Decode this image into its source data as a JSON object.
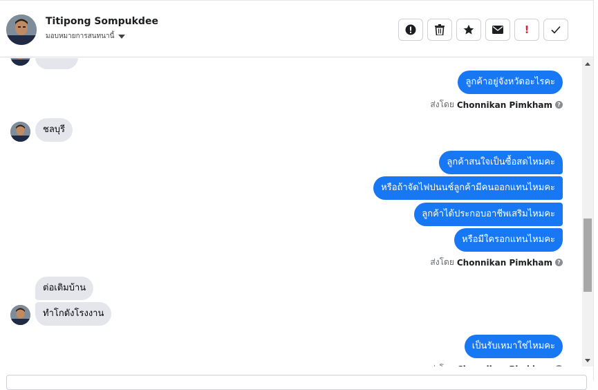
{
  "header": {
    "contact_name": "Titipong Sompukdee",
    "assign_label": "มอบหมายการสนทนานี้",
    "actions": [
      {
        "name": "report-spam-button",
        "icon": "alert-circle-icon"
      },
      {
        "name": "delete-button",
        "icon": "trash-icon"
      },
      {
        "name": "star-button",
        "icon": "star-icon"
      },
      {
        "name": "mark-unread-button",
        "icon": "envelope-icon"
      },
      {
        "name": "follow-up-button",
        "icon": "exclamation-icon",
        "label": "!"
      },
      {
        "name": "mark-done-button",
        "icon": "checkmark-icon"
      }
    ]
  },
  "messages": {
    "out1": "ลูกค้าอยู่จังหวัดอะไรคะ",
    "in1": "ชลบุรี",
    "out2": "ลูกค้าสนใจเป็นซื้อสดไหมคะ",
    "out3": "หรือถ้าจัดไฟปนนช์ลูกค้ามีคนออกแทนไหมคะ",
    "out4": "ลูกค้าได้ประกอบอาชีพเสริมไหมคะ",
    "out5": "หรือมีใครอกแทนไหมคะ",
    "in2": "ต่อเติมบ้าน",
    "in3": "ทำโกดังโรงงาน",
    "out6": "เป็นรับเหมาใช่ไหมคะ"
  },
  "sent_by": {
    "prefix": "ส่งโดย",
    "agent": "Chonnikan Pimkham"
  },
  "colors": {
    "outgoing_bubble": "#1877f2",
    "incoming_bubble": "#e4e6eb"
  }
}
